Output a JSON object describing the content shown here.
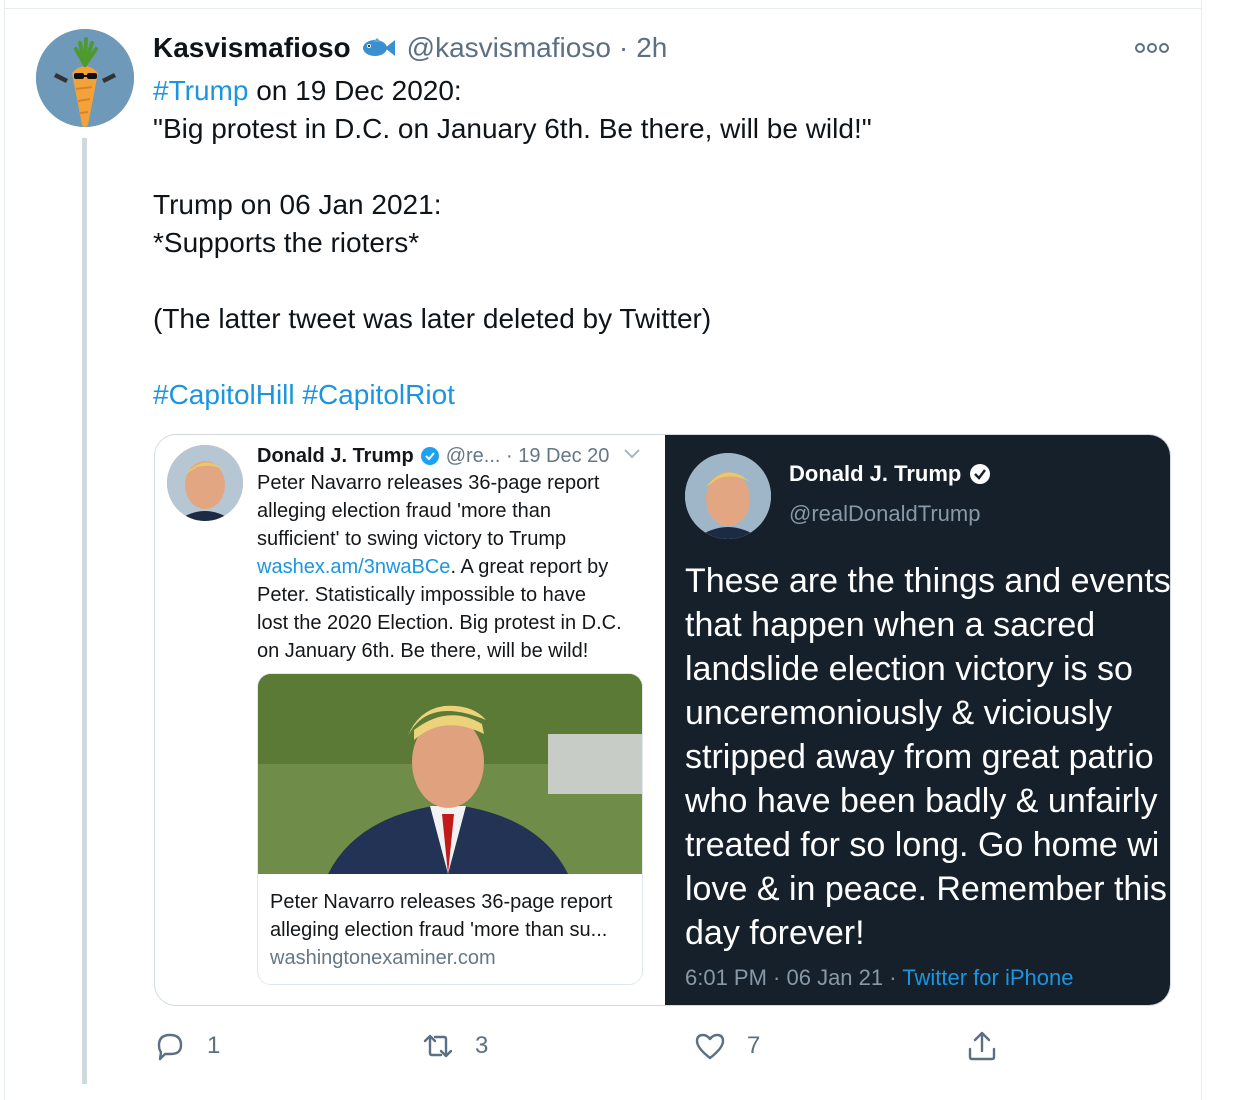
{
  "tweet": {
    "display_name": "Kasvismafioso",
    "name_emoji_icon": "fish-icon",
    "handle": "@kasvismafioso",
    "separator": "·",
    "time": "2h",
    "lines": [
      {
        "hashtag": "#Trump",
        "rest": " on 19 Dec 2020:"
      },
      {
        "text": "\"Big protest in D.C. on January 6th. Be there, will be wild!\""
      },
      {
        "text": ""
      },
      {
        "text": "Trump on 06 Jan 2021:"
      },
      {
        "text": "*Supports the rioters*"
      },
      {
        "text": ""
      },
      {
        "text": "(The latter tweet was later deleted by Twitter)"
      },
      {
        "text": ""
      }
    ],
    "hashtags_line": "#CapitolHill #CapitolRiot",
    "actions": {
      "reply_count": "1",
      "retweet_count": "3",
      "like_count": "7"
    }
  },
  "embedded_left": {
    "name": "Donald J. Trump",
    "meta": "@re... · 19 Dec 20",
    "body_lines": [
      "Peter Navarro releases 36-page report",
      "alleging election fraud 'more than",
      "sufficient' to swing victory to Trump"
    ],
    "link": "washex.am/3nwaBCe",
    "link_rest": ". A great report by",
    "body_lines_2": [
      "Peter. Statistically impossible to have",
      "lost the 2020 Election. Big protest in D.C.",
      "on January 6th. Be there, will be wild!"
    ],
    "card_title_1": "Peter Navarro releases 36-page report",
    "card_title_2": "alleging election fraud 'more than su...",
    "card_domain": "washingtonexaminer.com"
  },
  "embedded_right": {
    "name": "Donald J. Trump",
    "handle": "@realDonaldTrump",
    "body_lines": [
      "These are the things and events",
      "that happen when a sacred",
      "landslide election victory is so",
      "unceremoniously & viciously",
      "stripped away from great patrio",
      "who have been badly & unfairly",
      "treated for so long. Go home wi",
      "love & in peace. Remember this",
      "day forever!"
    ],
    "footer_time": "6:01 PM · 06 Jan 21 · ",
    "footer_source": "Twitter for iPhone"
  },
  "colors": {
    "link": "#1b95e0",
    "muted": "#5b7083",
    "dark_bg": "#15202b"
  }
}
